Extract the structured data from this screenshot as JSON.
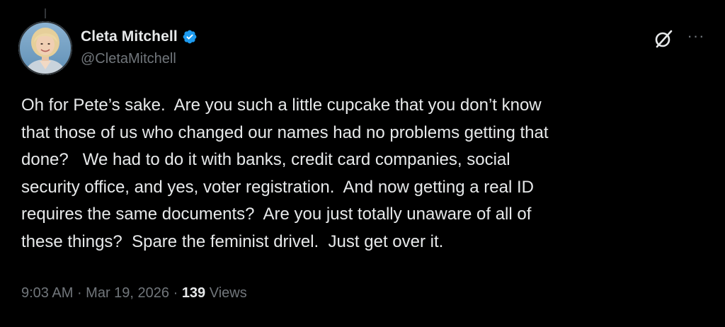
{
  "author": {
    "display_name": "Cleta Mitchell",
    "handle": "@CletaMitchell",
    "verified_badge": "verified-badge-icon",
    "badge_color": "#1d9bf0"
  },
  "actions": {
    "grok_icon": "grok-icon",
    "more_icon": "more-options-icon",
    "more_glyph": "···"
  },
  "tweet": {
    "lines": [
      "Oh for Pete’s sake.  Are you such a little cupcake that you don’t know",
      "that those of us who changed our names had no problems getting that",
      "done?   We had to do it with banks, credit card companies, social",
      "security office, and yes, voter registration.  And now getting a real ID",
      "requires the same documents?  Are you just totally unaware of all of",
      "these things?  Spare the feminist drivel.  Just get over it."
    ]
  },
  "meta": {
    "time": "9:03 AM",
    "separator": " · ",
    "date": "Mar 19, 2026",
    "views_count": "139",
    "views_label": " Views"
  }
}
